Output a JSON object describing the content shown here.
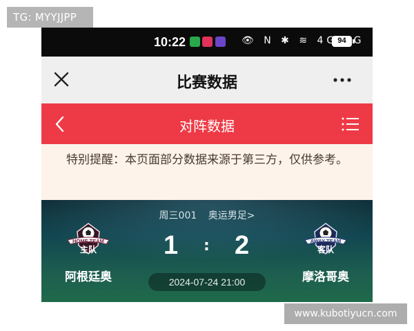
{
  "watermarks": {
    "top_left": "TG: MYYJJPP",
    "bottom_right": "www.kubotiyucn.com"
  },
  "status_bar": {
    "time": "10:22",
    "icons": [
      "eye-icon",
      "nfc-icon",
      "bluetooth-icon",
      "wifi-icon",
      "4g-signal-icon",
      "5g-signal-icon"
    ],
    "network_text": "👁 N ✱ ≋ 4G 5G",
    "battery": "94"
  },
  "app_header": {
    "title": "比赛数据"
  },
  "sub_header": {
    "title": "对阵数据"
  },
  "notice": {
    "text": "特别提醒：本页面部分数据来源于第三方，仅供参考。"
  },
  "match": {
    "match_no": "周三001",
    "competition": "奥运男足>",
    "home": {
      "badge_line1": "HOME TEAM",
      "badge_line2": "主队",
      "name": "阿根廷奥",
      "score": "1"
    },
    "away": {
      "badge_line1": "AWAY TEAM",
      "badge_line2": "客队",
      "name": "摩洛哥奥",
      "score": "2"
    },
    "score_separator": ":",
    "datetime": "2024-07-24 21:00"
  },
  "colors": {
    "accent_red": "#ee3a46",
    "notice_bg": "#fdf3ea",
    "status_bg": "#0b0b0b"
  }
}
